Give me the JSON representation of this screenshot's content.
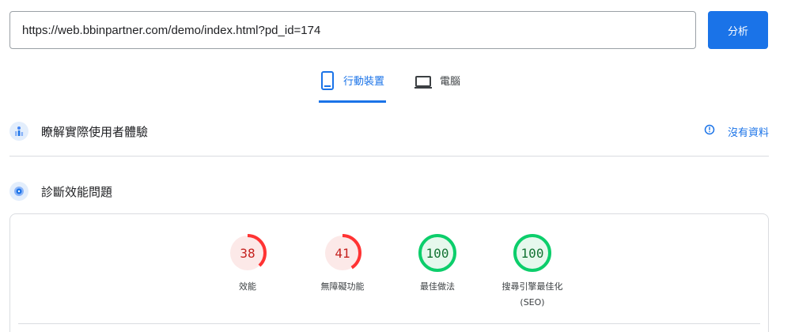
{
  "search": {
    "url_value": "https://web.bbinpartner.com/demo/index.html?pd_id=174"
  },
  "analyze_button": {
    "label": "分析"
  },
  "tabs": [
    {
      "label": "行動裝置",
      "icon": "phone-icon",
      "selected": true
    },
    {
      "label": "電腦",
      "icon": "laptop-icon",
      "selected": false
    }
  ],
  "field_section": {
    "title": "瞭解實際使用者體驗",
    "icon": "users-chart-icon",
    "no_data_label": "沒有資料",
    "no_data_icon": "info-icon"
  },
  "lab_section": {
    "title": "診斷效能問題",
    "icon": "lighthouse-icon"
  },
  "scores": [
    {
      "value": 38,
      "label": "效能",
      "label2": "",
      "status": "fail"
    },
    {
      "value": 41,
      "label": "無障礙功能",
      "label2": "",
      "status": "fail"
    },
    {
      "value": 100,
      "label": "最佳做法",
      "label2": "",
      "status": "pass"
    },
    {
      "value": 100,
      "label": "搜尋引擎最佳化",
      "label2": "(SEO)",
      "status": "pass"
    }
  ],
  "colors": {
    "accent": "#1a73e8",
    "fail": "#ff3333",
    "fail_bg": "#fce9e8",
    "fail_text": "#c5221f",
    "pass": "#0cce6b",
    "pass_bg": "#e6f8ed",
    "pass_text": "#137333"
  }
}
